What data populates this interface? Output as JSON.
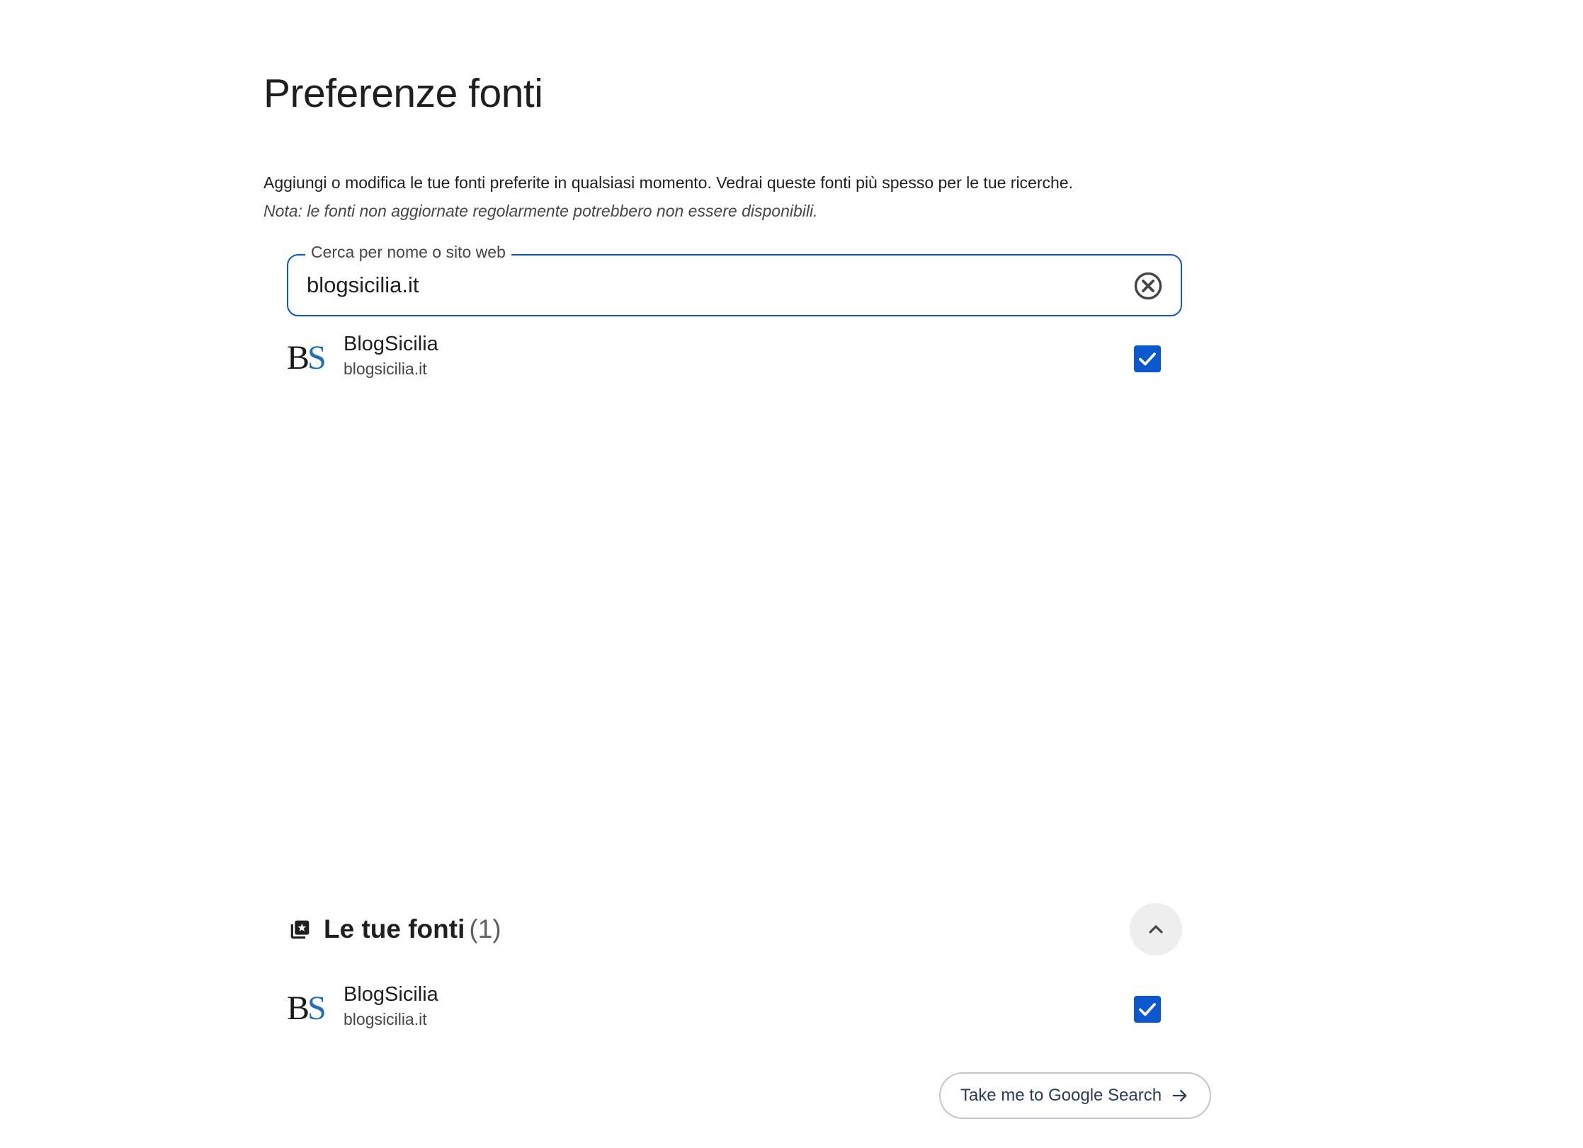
{
  "page": {
    "title": "Preferenze fonti",
    "intro": "Aggiungi o modifica le tue fonti preferite in qualsiasi momento. Vedrai queste fonti più spesso per le tue ricerche.",
    "note": "Nota: le fonti non aggiornate regolarmente potrebbero non essere disponibili."
  },
  "search": {
    "label": "Cerca per nome o sito web",
    "value": "blogsicilia.it",
    "clear_icon": "close-circle-icon"
  },
  "results": [
    {
      "logo_text_b": "B",
      "logo_text_s": "S",
      "name": "BlogSicilia",
      "domain": "blogsicilia.it",
      "checked": true
    }
  ],
  "your_sources": {
    "icon": "library-star-icon",
    "title": "Le tue fonti",
    "count": "(1)",
    "toggle_icon": "chevron-up-icon",
    "items": [
      {
        "logo_text_b": "B",
        "logo_text_s": "S",
        "name": "BlogSicilia",
        "domain": "blogsicilia.it",
        "checked": true
      }
    ]
  },
  "cta": {
    "label": "Take me to Google Search",
    "icon": "arrow-right-icon"
  },
  "colors": {
    "accent": "#0b57d0",
    "logo_s": "#1f6fb8",
    "text": "#1f1f1f",
    "secondary_text": "#444746"
  }
}
